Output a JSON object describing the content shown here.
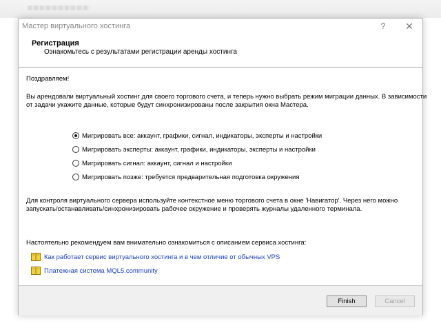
{
  "window": {
    "title": "Мастер виртуального хостинга",
    "help": "?",
    "close": "✕"
  },
  "header": {
    "title": "Регистрация",
    "subtitle": "Ознакомьтесь с результатами регистрации аренды хостинга"
  },
  "body": {
    "greeting": "Поздравляем!",
    "intro_line1": "Вы арендовали виртуальный хостинг для своего торгового счета, и теперь нужно выбрать режим миграции данных. В зависимости",
    "intro_line2": "от задачи укажите данные, которые будут синхронизированы после закрытия окна Мастера.",
    "options": [
      {
        "label": "Мигрировать все: аккаунт, графики, сигнал, индикаторы, эксперты и настройки",
        "checked": true
      },
      {
        "label": "Мигрировать эксперты: аккаунт, графики, индикаторы, эксперты и настройки",
        "checked": false
      },
      {
        "label": "Мигрировать сигнал: аккаунт, сигнал и настройки",
        "checked": false
      },
      {
        "label": "Мигрировать позже: требуется предварительная подготовка окружения",
        "checked": false
      }
    ],
    "note_line1": "Для контроля виртуального сервера используйте контекстное меню торгового счета в окне 'Навигатор'. Через него можно",
    "note_line2": "запускать/останавливать/синхронизировать рабочее окружение и проверять журналы удаленного терминала.",
    "recommend": "Настоятельно рекомендуем вам внимательно ознакомиться с описанием сервиса хостинга:",
    "links": [
      {
        "label": "Как работает сервис виртуального хостинга и в чем отличие от обычных VPS",
        "icon": "book-icon"
      },
      {
        "label": "Платежная система MQL5.community",
        "icon": "book-icon"
      }
    ]
  },
  "footer": {
    "finish_label": "Finish",
    "cancel_label": "Cancel"
  },
  "colors": {
    "link": "#1a3fbf",
    "footer_bg": "#f0f0f0",
    "disabled_text": "#a3a3a3"
  }
}
